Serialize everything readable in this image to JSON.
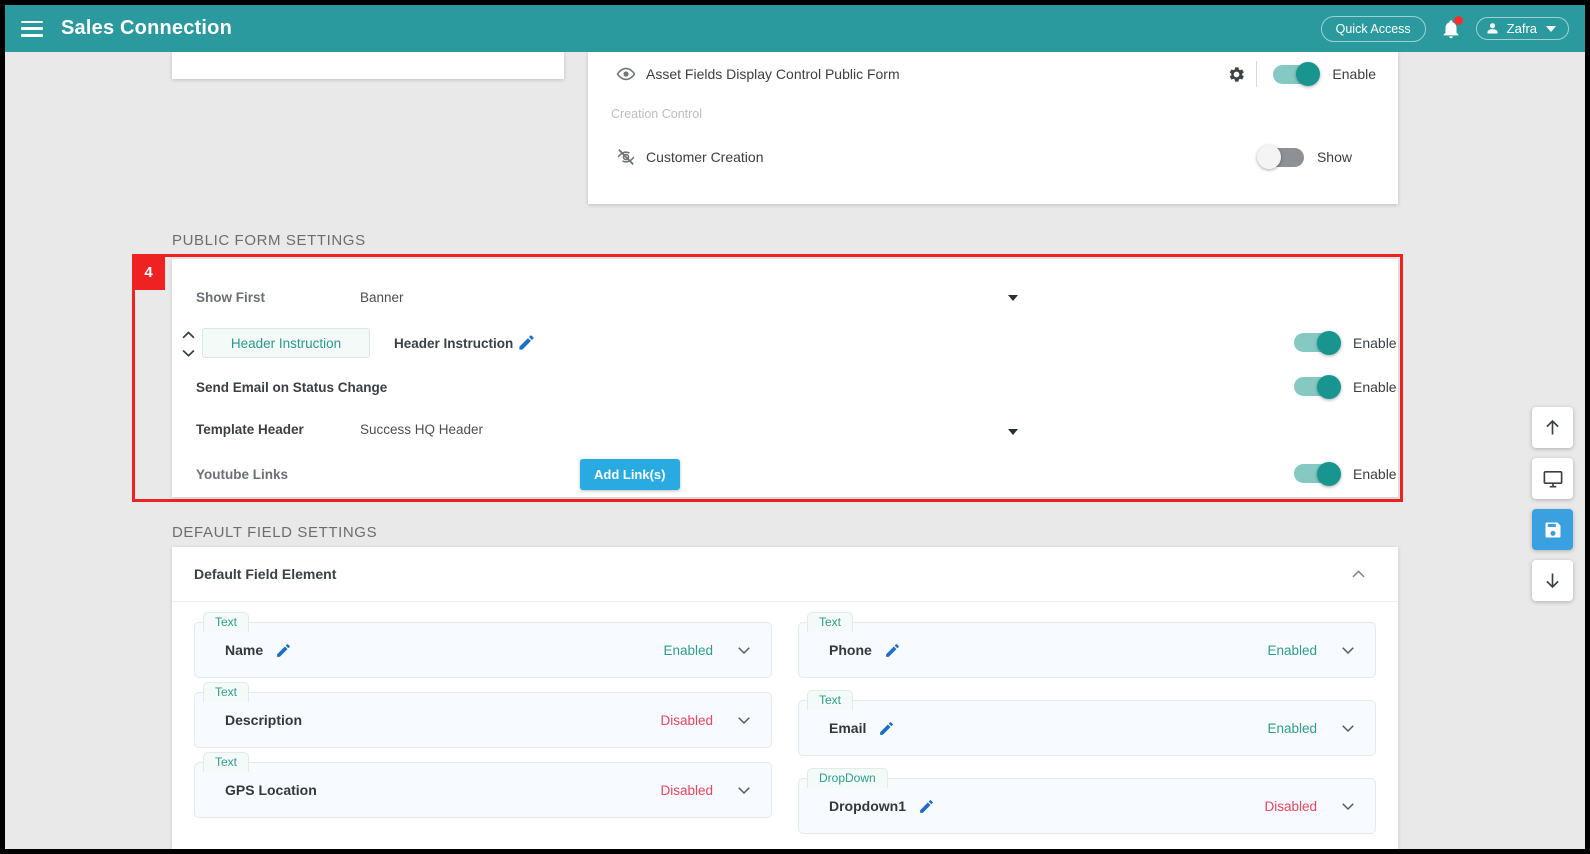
{
  "topbar": {
    "menu_icon": "hamburger-icon",
    "title": "Sales Connection",
    "quick_access_label": "Quick Access",
    "notification_icon": "bell-icon",
    "user_name": "Zafra",
    "brand_color": "#2a9a9e"
  },
  "asset_card": {
    "rows": [
      {
        "icon": "eye-icon",
        "label": "Asset Fields Display Control Public Form",
        "has_gear": true,
        "toggle_state": "on",
        "toggle_label": "Enable"
      }
    ],
    "creation_control_heading": "Creation Control",
    "creation_rows": [
      {
        "icon": "eye-off-icon",
        "label": "Customer Creation",
        "has_gear": false,
        "toggle_state": "off",
        "toggle_label": "Show"
      }
    ]
  },
  "public_form_settings": {
    "title": "PUBLIC FORM SETTINGS",
    "highlight_badge": "4",
    "highlight_color": "#ee2222",
    "rows": {
      "show_first": {
        "label": "Show First",
        "value": "Banner"
      },
      "header_instruction": {
        "chip": "Header Instruction",
        "label": "Header Instruction",
        "toggle_state": "on",
        "toggle_label": "Enable"
      },
      "send_email": {
        "label": "Send Email on Status Change",
        "toggle_state": "on",
        "toggle_label": "Enable"
      },
      "template_header": {
        "label": "Template Header",
        "value": "Success HQ Header"
      },
      "youtube_links": {
        "label": "Youtube Links",
        "button_label": "Add Link(s)",
        "button_color": "#29abe2",
        "toggle_state": "on",
        "toggle_label": "Enable"
      }
    }
  },
  "default_field_settings": {
    "title": "DEFAULT FIELD SETTINGS",
    "panel_title": "Default Field Element",
    "collapse_icon": "chevron-up-icon",
    "columns": {
      "left": [
        {
          "tag": "Text",
          "name": "Name",
          "has_pencil": true,
          "status": "Enabled",
          "status_kind": "enabled"
        },
        {
          "tag": "Text",
          "name": "Description",
          "has_pencil": false,
          "status": "Disabled",
          "status_kind": "disabled"
        },
        {
          "tag": "Text",
          "name": "GPS Location",
          "has_pencil": false,
          "status": "Disabled",
          "status_kind": "disabled"
        }
      ],
      "right": [
        {
          "tag": "Text",
          "name": "Phone",
          "has_pencil": true,
          "status": "Enabled",
          "status_kind": "enabled"
        },
        {
          "tag": "Text",
          "name": "Email",
          "has_pencil": true,
          "status": "Enabled",
          "status_kind": "enabled"
        },
        {
          "tag": "DropDown",
          "name": "Dropdown1",
          "has_pencil": true,
          "status": "Disabled",
          "status_kind": "disabled"
        }
      ]
    }
  },
  "fab_rail": [
    {
      "icon": "arrow-up-icon",
      "style": "white"
    },
    {
      "icon": "monitor-icon",
      "style": "white"
    },
    {
      "icon": "save-icon",
      "style": "blue"
    },
    {
      "icon": "arrow-down-icon",
      "style": "white"
    }
  ]
}
